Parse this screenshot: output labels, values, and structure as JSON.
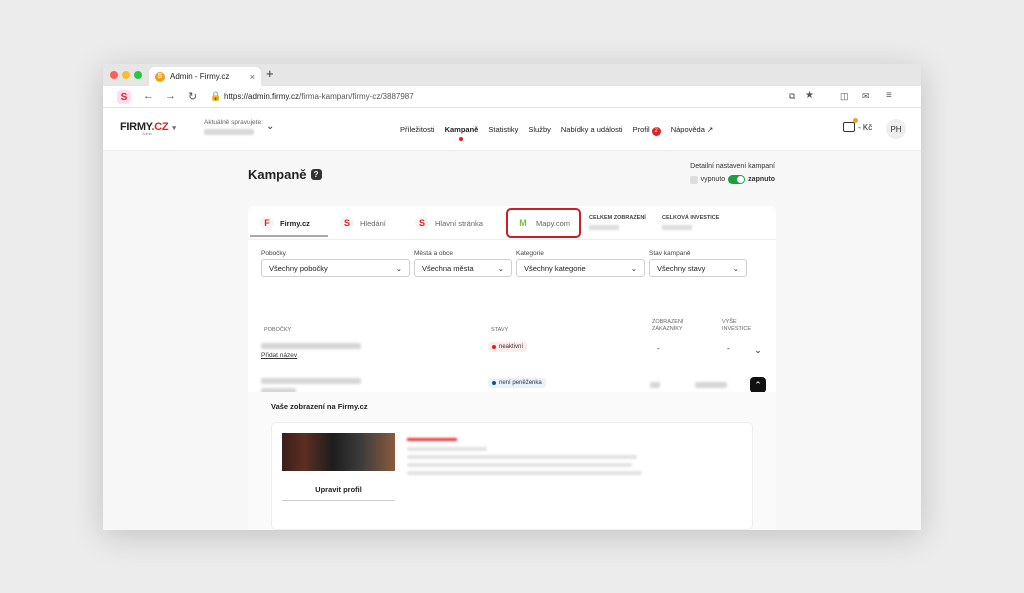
{
  "browser": {
    "tab_title": "Admin - Firmy.cz",
    "url_host": "https://admin.firmy.cz",
    "url_path": "/firma-kampan/firmy-cz/3887987",
    "new_tab": "+",
    "close": "×"
  },
  "header": {
    "logo_firmy": "FIRMY",
    "logo_cz": ".CZ",
    "logo_sub": "Admin",
    "manager_label": "Aktuálně spravujete:",
    "nav": [
      "Příležitosti",
      "Kampaně",
      "Statistiky",
      "Služby",
      "Nabídky a události",
      "Profil",
      "Nápověda"
    ],
    "profil_badge": "2",
    "wallet": "- Kč",
    "avatar": "PH"
  },
  "page": {
    "title": "Kampaně",
    "help": "?",
    "detail_label": "Detailní nastavení kampaní",
    "toggle_off": "vypnuto",
    "toggle_on": "zapnuto"
  },
  "tabs": {
    "firmy": "Firmy.cz",
    "hledani": "Hledání",
    "hlavni": "Hlavní stránka",
    "mapy": "Mapy.com",
    "stat_zobrazeni": "CELKEM ZOBRAZENÍ",
    "stat_investice": "CELKOVÁ INVESTICE"
  },
  "filters": {
    "pobocky_label": "Pobočky",
    "pobocky_value": "Všechny pobočky",
    "mesta_label": "Města a obce",
    "mesta_value": "Všechna města",
    "kategorie_label": "Kategorie",
    "kategorie_value": "Všechny kategorie",
    "stav_label": "Stav kampaně",
    "stav_value": "Všechny stavy"
  },
  "table": {
    "col_pobocky": "POBOČKY",
    "col_stavy": "STAVY",
    "col_zobrazeni": "ZOBRAZENÍ ZÁKAZNÍKY",
    "col_investice": "VÝŠE INVESTICE",
    "rows": [
      {
        "status": "neaktivní",
        "link": "Přidat název",
        "zobrazeni": "-",
        "investice": "-"
      },
      {
        "status": "není peněženka"
      }
    ]
  },
  "preview": {
    "title": "Vaše zobrazení na Firmy.cz",
    "edit_button": "Upravit profil"
  },
  "colors": {
    "brand_red": "#d22222",
    "highlight": "#c81e24",
    "toggle_green": "#1e9e3e"
  }
}
